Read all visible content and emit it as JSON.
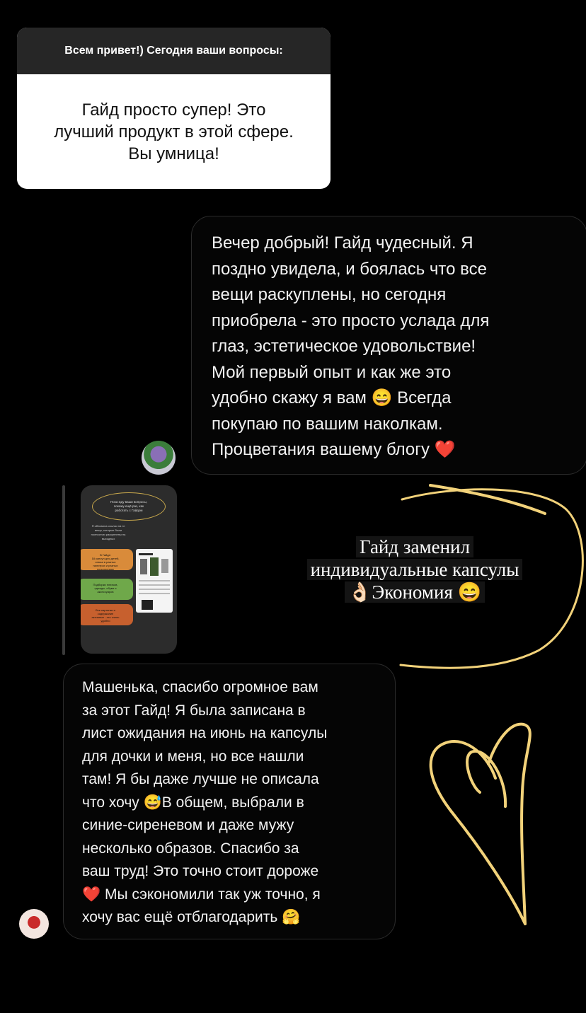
{
  "question_sticker": {
    "header": "Всем привет!) Сегодня ваши вопросы:",
    "answer": "Гайд просто супер! Это\nлучший продукт в этой сфере.\nВы умница!"
  },
  "messages": [
    {
      "text": "Вечер добрый! Гайд чудесный. Я\nпоздно увидела, и боялась что все\nвещи раскуплены, но сегодня\nприобрела - это просто услада для\nглаз, эстетическое удовольствие!\nМой первый опыт и как же это\nудобно скажу я вам 😄 Всегда\nпокупаю по вашим наколкам.\nПроцветания вашему блогу ❤️"
    },
    {
      "text": "Машенька, спасибо огромное вам\nза этот Гайд! Я была записана в\nлист ожидания на июнь на капсулы\nдля дочки и меня, но все нашли\nтам! Я бы даже лучше не описала\nчто хочу 😅В общем, выбрали в\nсиние-сиреневом и даже мужу\nнесколько образов. Спасибо за\nваш труд! Это точно стоит дороже\n❤️ Мы сэкономили так уж точно, я\nхочу вас ещё отблагодарить 🤗"
    }
  ],
  "thumbnail": {
    "oval_text": "Пока жду ваши вопросы,\nпокажу ещё раз, как\nработать с Гайдом",
    "intro_text": "Я обновила ссылки на те\nвещи, которые были\nполностью раскуплены на\nвыходных",
    "swatches": [
      {
        "text": "В Гайде:\n18 капсул для детей,\nсемьи в разных\nпалитрах и разных\nпонолнениях",
        "color": "#d98b3a"
      },
      {
        "text": "Подборки платков,\nодежды, обуви и\nаксессуаров",
        "color": "#6fa84a"
      },
      {
        "text": "Все картинки и\nсодержание\nактивные - это очень\nудобно",
        "color": "#c7602e"
      }
    ]
  },
  "overlay": {
    "lines": [
      "Гайд заменил",
      "индивидуальные капсулы",
      "👌🏻Экономия 😄"
    ],
    "accent_color": "#f2d27a"
  }
}
